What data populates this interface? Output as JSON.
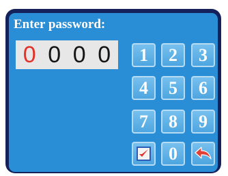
{
  "title": "Enter password:",
  "display": {
    "digits": [
      "0",
      "0",
      "0",
      "0"
    ],
    "active_index": 0
  },
  "keypad": {
    "keys": [
      "1",
      "2",
      "3",
      "4",
      "5",
      "6",
      "7",
      "8",
      "9",
      "0"
    ],
    "confirm_icon": "checkmark-icon",
    "back_icon": "back-arrow-icon"
  },
  "colors": {
    "panel": "#2a8ed6",
    "frame": "#14215a",
    "active_digit": "#e2322a",
    "check": "#e2322a",
    "back_arrow": "#e04035"
  }
}
